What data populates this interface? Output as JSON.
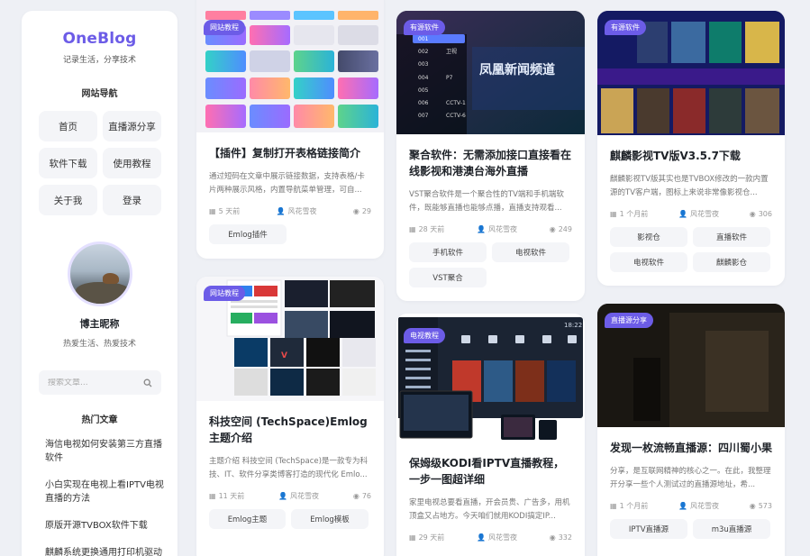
{
  "sidebar": {
    "logo": "OneBlog",
    "tagline": "记录生活，分享技术",
    "nav_title": "网站导航",
    "nav_items": [
      {
        "label": "首页"
      },
      {
        "label": "直播源分享"
      },
      {
        "label": "软件下载"
      },
      {
        "label": "使用教程"
      },
      {
        "label": "关于我"
      },
      {
        "label": "登录"
      }
    ],
    "blogger_name": "博主昵称",
    "blogger_desc": "热爱生活、热爱技术",
    "search_placeholder": "搜索文章...",
    "hot_title": "热门文章",
    "hot_articles": [
      "海信电视如何安装第三方直播软件",
      "小白实现在电视上看IPTV电视直播的方法",
      "原版开源TVBOX软件下载",
      "麒麟系统更换通用打印机驱动教程"
    ]
  },
  "colors": {
    "accent": "#6c5ce7",
    "bg": "#eef0f5"
  },
  "cards": [
    {
      "badge": "网站教程",
      "title": "【插件】复制打开表格链接简介",
      "excerpt": "通过短码在文章中展示链接数据，支持表格/卡片两种展示风格，内置导航菜单管理，可自...",
      "time": "5 天前",
      "author": "风花雪夜",
      "views": "29",
      "tags": [
        "Emlog插件"
      ]
    },
    {
      "badge": "网站教程",
      "title": "科技空间 (TechSpace)Emlog主题介绍",
      "excerpt": "主题介绍 科技空间 (TechSpace)是一款专为科技、IT、软件分享类博客打造的现代化 Emlo...",
      "time": "11 天前",
      "author": "风花雪夜",
      "views": "76",
      "tags": [
        "Emlog主题",
        "Emlog模板"
      ]
    },
    {
      "badge": "有源软件",
      "title": "聚合软件：无需添加接口直接看在线影视和港澳台海外直播",
      "excerpt": "VST聚合软件是一个聚合性的TV端和手机端软件，既能够直播也能够点播，直播支持观看...",
      "time": "28 天前",
      "author": "风花雪夜",
      "views": "249",
      "tags": [
        "手机软件",
        "电视软件",
        "VST聚合"
      ],
      "thumb_channels": [
        "001",
        "002",
        "003",
        "004",
        "005",
        "006",
        "007"
      ],
      "thumb_banner": "凤凰新闻频道",
      "thumb_labels": [
        "卫视",
        "P7",
        "CCTV-1",
        "CCTV-6"
      ]
    },
    {
      "badge": "电视教程",
      "title": "保姆级KODI看IPTV直播教程，一步一图超详细",
      "excerpt": "家里电视总要看直播，开会员贵、广告多，用机顶盒又占地方。今天咱们就用KODI搞定IP...",
      "time": "29 天前",
      "author": "风花雪夜",
      "views": "332",
      "tags": [],
      "thumb_clock": "18:22"
    },
    {
      "badge": "有源软件",
      "title": "麒麟影视TV版V3.5.7下载",
      "excerpt": "麒麟影视TV版其实也是TVBOX修改的一款内置源的TV客户端，图标上来说非常像影视仓...",
      "time": "1 个月前",
      "author": "风花雪夜",
      "views": "306",
      "tags": [
        "影视仓",
        "直播软件",
        "电视软件",
        "麒麟影仓"
      ]
    },
    {
      "badge": "直播源分享",
      "title": "发现一枚流畅直播源：四川蜀小果",
      "excerpt": "分享，是互联网精神的核心之一。在此，我整理开分享一些个人测试过的直播源地址，希...",
      "time": "1 个月前",
      "author": "风花雪夜",
      "views": "573",
      "tags": [
        "IPTV直播源",
        "m3u直播源"
      ]
    }
  ]
}
